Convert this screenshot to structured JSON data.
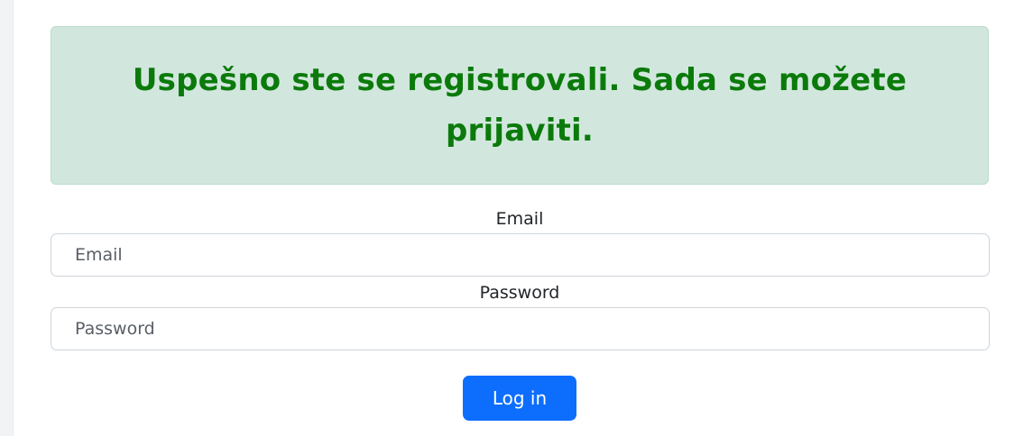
{
  "alert": {
    "message": "Uspešno ste se registrovali. Sada se možete prijaviti.",
    "text_color": "#0b7a0b",
    "background_color": "#d1e7dd"
  },
  "form": {
    "email_label": "Email",
    "email_placeholder": "Email",
    "email_value": "",
    "password_label": "Password",
    "password_placeholder": "Password",
    "password_value": "",
    "submit_label": "Log in",
    "submit_color": "#0d6efd"
  }
}
